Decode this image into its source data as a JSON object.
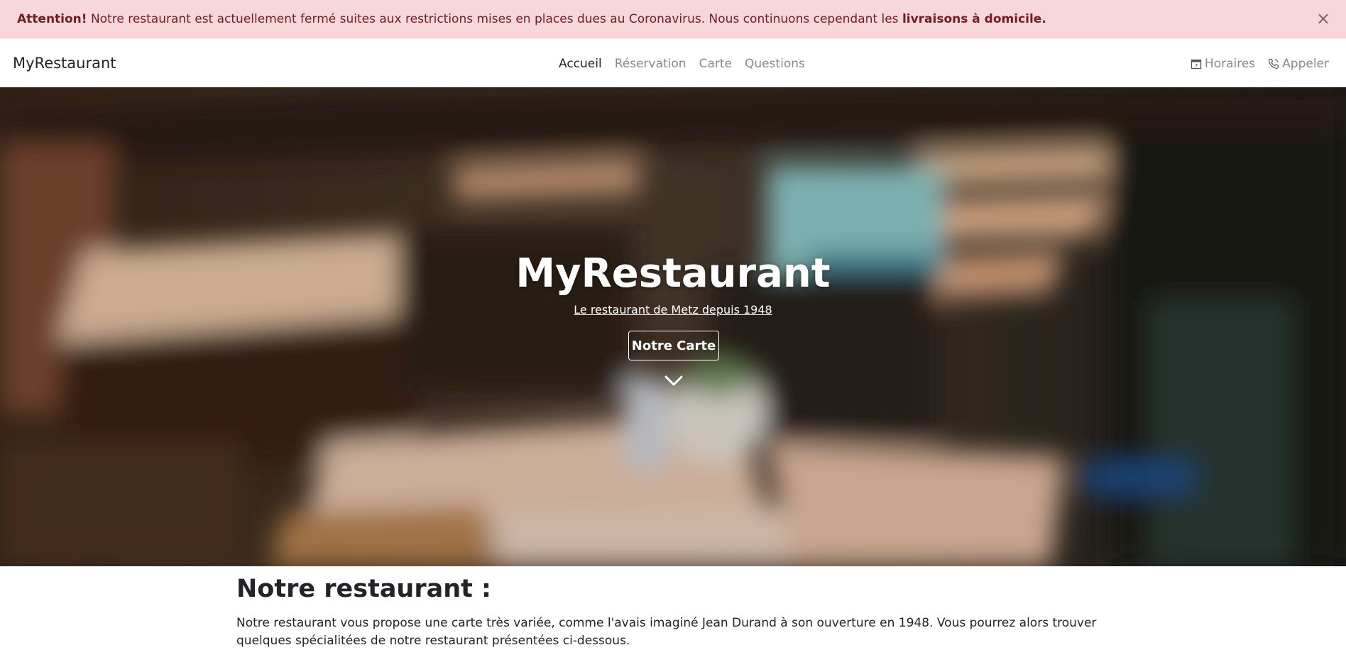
{
  "alert": {
    "prefix": "Attention!",
    "message": "Notre restaurant est actuellement fermé suites aux restrictions mises en places dues au Coronavirus. Nous continuons cependant les",
    "emphasis": "livraisons à domicile.",
    "close_symbol": "×",
    "colors": {
      "background": "#f8d7da",
      "text": "#721c24"
    }
  },
  "navbar": {
    "brand": "MyRestaurant",
    "links": [
      {
        "label": "Accueil",
        "active": true
      },
      {
        "label": "Réservation",
        "active": false
      },
      {
        "label": "Carte",
        "active": false
      },
      {
        "label": "Questions",
        "active": false
      }
    ],
    "right": [
      {
        "icon": "calendar-icon",
        "label": "Horaires"
      },
      {
        "icon": "phone-icon",
        "label": "Appeler"
      }
    ]
  },
  "hero": {
    "title": "MyRestaurant",
    "subtitle": "Le restaurant de Metz depuis 1948",
    "button_label": "Notre Carte",
    "scroll_icon": "chevron-down-icon"
  },
  "section": {
    "title": "Notre restaurant :",
    "text": "Notre restaurant vous propose une carte très variée, comme l'avais imaginé Jean Durand à son ouverture en 1948. Vous pourrez alors trouver quelques spécialitées de notre restaurant présentées ci-dessous."
  }
}
